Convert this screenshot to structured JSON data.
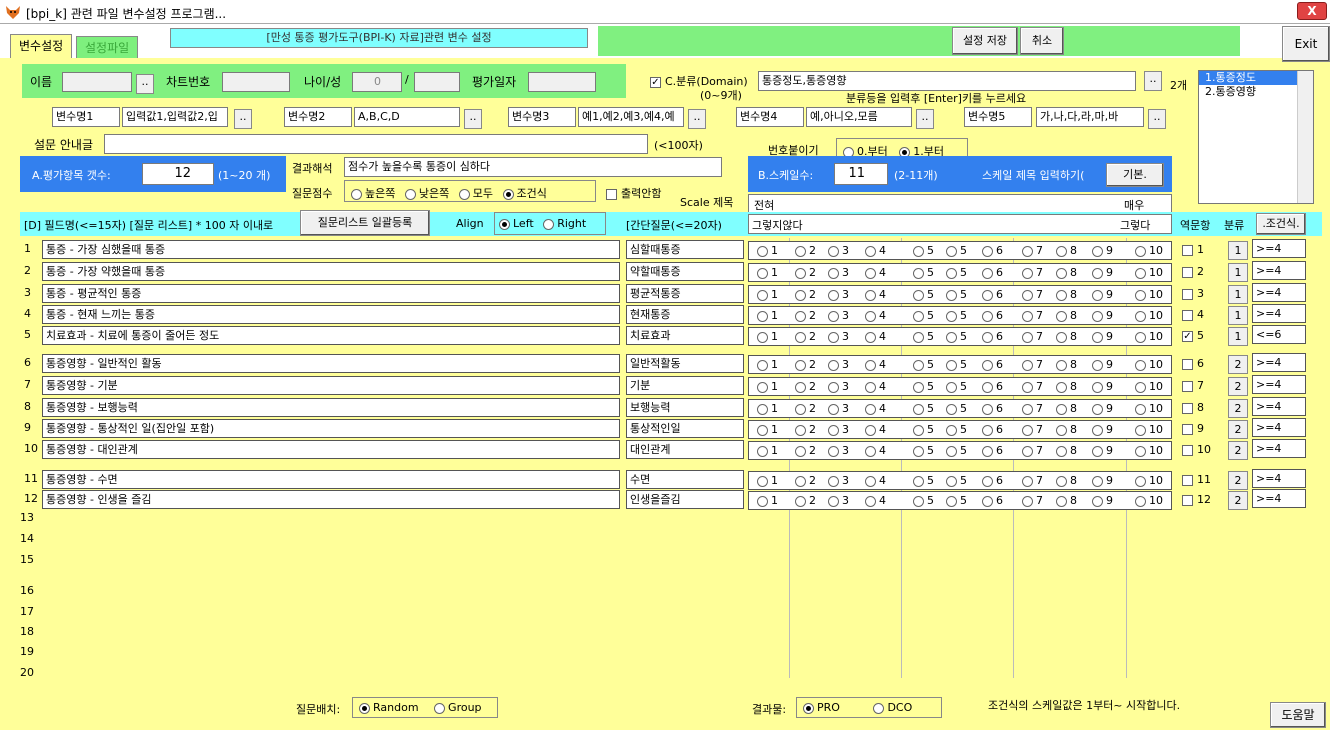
{
  "window": {
    "title": "[bpi_k] 관련 파일 변수설정 프로그램...",
    "close": "X"
  },
  "tabs": [
    "변수설정",
    "설정파일"
  ],
  "header_banner": "[만성 통증 평가도구(BPI-K) 자료]관련 변수 설정",
  "buttons": {
    "save": "설정 저장",
    "cancel": "취소",
    "exit": "Exit",
    "help": "도움말",
    "dots": "..",
    "bulk_register": "질문리스트 일괄등록",
    "scale_default": "기본.",
    "condition": ".조건식."
  },
  "patient": {
    "name_label": "이름",
    "chart_label": "차트번호",
    "age_sex_label": "나이/성",
    "age_value": "0",
    "slash": "/",
    "date_label": "평가일자"
  },
  "classification": {
    "label": "C.분류(Domain)",
    "range": "(0~9개)",
    "value": "통증정도,통증영향",
    "hint": "분류등을 입력후 [Enter]키를 누르세요",
    "count": "2개",
    "items": [
      "1.통증정도",
      "2.통증영향"
    ]
  },
  "variables": [
    {
      "label": "변수명1",
      "value": "입력값1,입력값2,입"
    },
    {
      "label": "변수명2",
      "value": "A,B,C,D"
    },
    {
      "label": "변수명3",
      "value": "예1,예2,예3,예4,예"
    },
    {
      "label": "변수명4",
      "value": "예,아니오,모름"
    },
    {
      "label": "변수명5",
      "value": "가,나,다,라,마,바"
    }
  ],
  "guide": {
    "label": "설문 안내글",
    "limit": "(<100자)"
  },
  "numbering": {
    "label": "번호붙이기",
    "opt0": "0.부터",
    "opt1": "1.부터"
  },
  "items_count": {
    "label": "A.평가항목 갯수:",
    "value": "12",
    "range": "(1~20 개)"
  },
  "result": {
    "label": "결과해석",
    "value": "점수가 높을수록 통증이 심하다"
  },
  "score": {
    "label": "질문점수",
    "opts": [
      "높은쪽",
      "낮은쪽",
      "모두",
      "조건식"
    ],
    "no_output": "출력안함"
  },
  "scale": {
    "label": "B.스케일수:",
    "value": "11",
    "range": "(2-11개)",
    "title_prompt": "스케일 제목 입력하기(",
    "title_label": "Scale 제목",
    "left_anchor": "전혀",
    "right_anchor": "매우",
    "left_anchor2": "그렇지않다",
    "right_anchor2": "그렇다"
  },
  "list_header": {
    "field": "[D] 필드명(<=15자) [질문 리스트] * 100 자 이내로",
    "align_label": "Align",
    "left": "Left",
    "right": "Right",
    "short": "[간단질문(<=20자)",
    "reverse": "역문항",
    "category": "분류"
  },
  "scale_labels": [
    "1",
    "2",
    "3",
    "4",
    "5",
    "5",
    "6",
    "7",
    "8",
    "9",
    "10"
  ],
  "rows": [
    {
      "n": "1",
      "q": "통증 - 가장 심했을때 통증",
      "s": "심할때통증",
      "checked": false,
      "cat": "1",
      "cond": ">=4"
    },
    {
      "n": "2",
      "q": "통증 - 가장 약했을때 통증",
      "s": "약할때통증",
      "checked": false,
      "cat": "1",
      "cond": ">=4"
    },
    {
      "n": "3",
      "q": "통증 - 평균적인 통증",
      "s": "평균적통증",
      "checked": false,
      "cat": "1",
      "cond": ">=4"
    },
    {
      "n": "4",
      "q": "통증 - 현재 느끼는 통증",
      "s": "현재통증",
      "checked": false,
      "cat": "1",
      "cond": ">=4"
    },
    {
      "n": "5",
      "q": "치료효과 - 치료에 통증이 줄어든 정도",
      "s": "치료효과",
      "checked": true,
      "cat": "1",
      "cond": "<=6"
    },
    {
      "n": "6",
      "q": "통증영향 - 일반적인 활동",
      "s": "일반적활동",
      "checked": false,
      "cat": "2",
      "cond": ">=4"
    },
    {
      "n": "7",
      "q": "통증영향 - 기분",
      "s": "기분",
      "checked": false,
      "cat": "2",
      "cond": ">=4"
    },
    {
      "n": "8",
      "q": "통증영향 - 보행능력",
      "s": "보행능력",
      "checked": false,
      "cat": "2",
      "cond": ">=4"
    },
    {
      "n": "9",
      "q": "통증영향 - 통상적인 일(집안일 포함)",
      "s": "통상적인일",
      "checked": false,
      "cat": "2",
      "cond": ">=4"
    },
    {
      "n": "10",
      "q": "통증영향 - 대인관계",
      "s": "대인관계",
      "checked": false,
      "cat": "2",
      "cond": ">=4"
    },
    {
      "n": "11",
      "q": "통증영향 - 수면",
      "s": "수면",
      "checked": false,
      "cat": "2",
      "cond": ">=4"
    },
    {
      "n": "12",
      "q": "통증영향 - 인생을 즐김",
      "s": "인생을즐김",
      "checked": false,
      "cat": "2",
      "cond": ">=4"
    }
  ],
  "empty_rows": [
    "13",
    "14",
    "15",
    "16",
    "17",
    "18",
    "19",
    "20"
  ],
  "footer": {
    "layout_label": "질문배치:",
    "random": "Random",
    "group": "Group",
    "result_label": "결과물:",
    "pro": "PRO",
    "dco": "DCO",
    "note": "조건식의 스케일값은 1부터~ 시작합니다."
  }
}
